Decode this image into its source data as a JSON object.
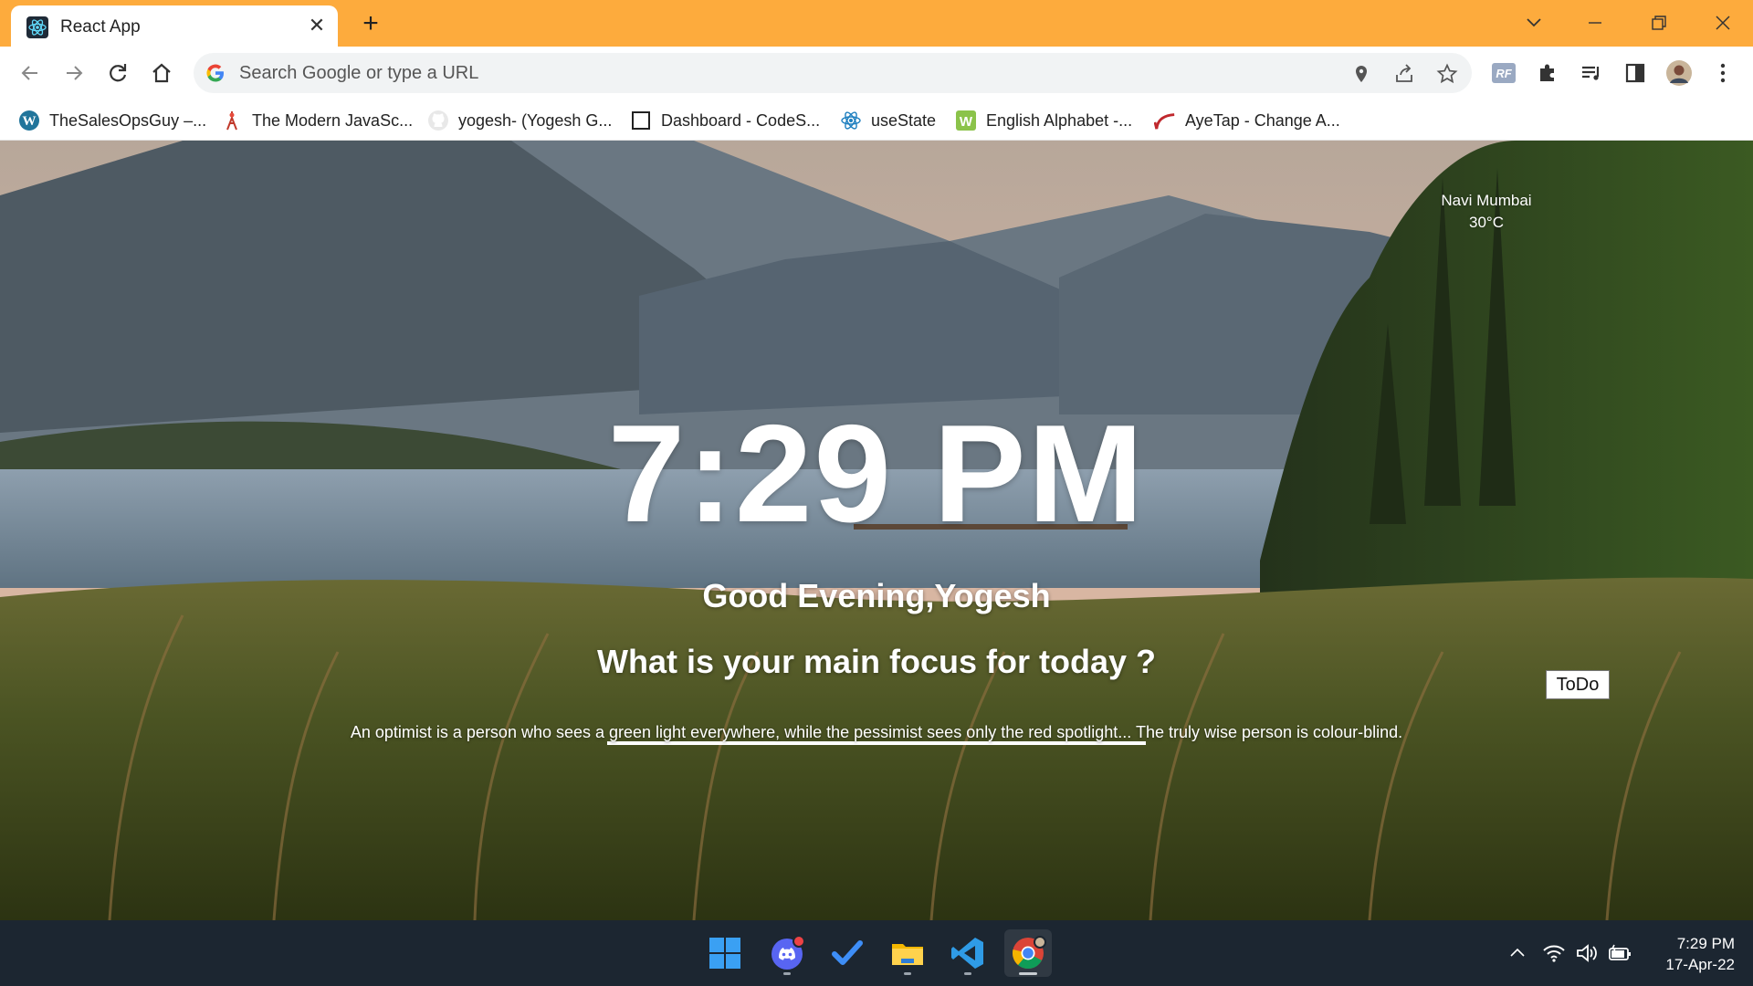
{
  "tab": {
    "title": "React App",
    "close": "✕",
    "new_tab": "+"
  },
  "window_controls": {
    "minimize": "minimize",
    "restore": "restore",
    "close": "close"
  },
  "omnibox": {
    "placeholder": "Search Google or type a URL",
    "value": ""
  },
  "bookmarks": [
    {
      "label": "TheSalesOpsGuy –...",
      "icon": "wordpress-icon"
    },
    {
      "label": "The Modern JavaSc...",
      "icon": "javascript-info-icon"
    },
    {
      "label": "yogesh- (Yogesh G...",
      "icon": "github-icon"
    },
    {
      "label": "Dashboard - CodeS...",
      "icon": "square-icon"
    },
    {
      "label": "useState",
      "icon": "react-icon"
    },
    {
      "label": "English Alphabet -...",
      "icon": "w-icon"
    },
    {
      "label": "AyeTap - Change A...",
      "icon": "ayetap-icon"
    }
  ],
  "weather": {
    "city": "Navi Mumbai",
    "temperature": "30°C"
  },
  "clock": {
    "time": "7:29 PM"
  },
  "greeting": {
    "text": "Good Evening,Yogesh"
  },
  "focus": {
    "question": "What is your main focus for today ?",
    "value": ""
  },
  "todo": {
    "label": "ToDo"
  },
  "quote": {
    "text": "An optimist is a person who sees a green light everywhere, while the pessimist sees only the red spotlight... The truly wise person is colour-blind."
  },
  "taskbar": {
    "apps": [
      "windows-start-icon",
      "discord-icon",
      "todo-icon",
      "file-explorer-icon",
      "vscode-icon",
      "chrome-icon"
    ],
    "time": "7:29 PM",
    "date": "17-Apr-22"
  },
  "colors": {
    "titlebar": "#fdab3d",
    "taskbar": "#1c2631",
    "text_on_image": "#ffffff"
  }
}
